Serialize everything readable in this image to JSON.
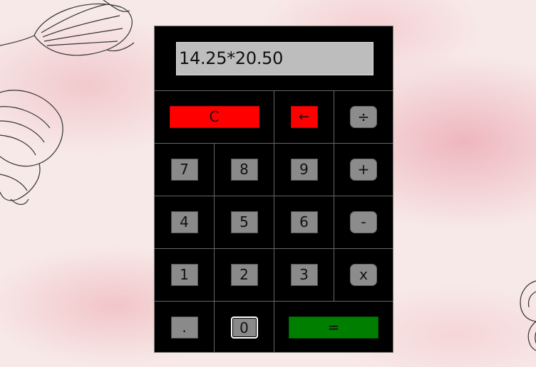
{
  "display": {
    "expression": "14.25*20.50"
  },
  "buttons": {
    "clear": "C",
    "backspace": "←",
    "divide": "÷",
    "seven": "7",
    "eight": "8",
    "nine": "9",
    "add": "+",
    "four": "4",
    "five": "5",
    "six": "6",
    "subtract": "-",
    "one": "1",
    "two": "2",
    "three": "3",
    "multiply": "x",
    "decimal": ".",
    "zero": "0",
    "equals": "="
  },
  "colors": {
    "calculator_bg": "#000000",
    "clear_button": "#ff0000",
    "equals_button": "#007e00",
    "digit_button": "#8a8a8a",
    "display_bg": "#bdbdbd"
  }
}
